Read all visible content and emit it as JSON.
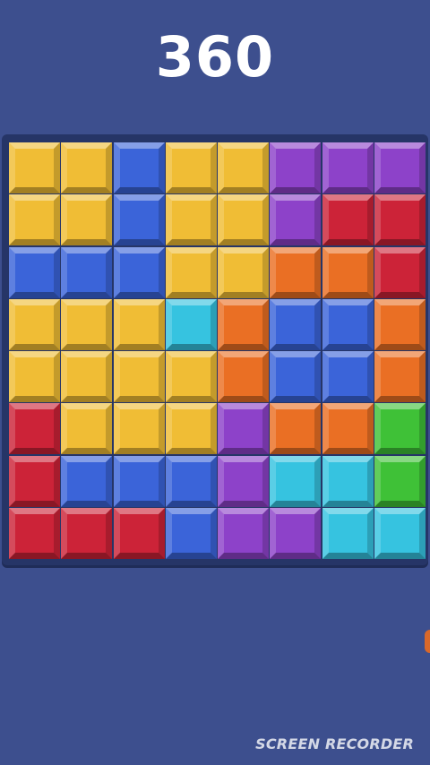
{
  "game": {
    "score": "360",
    "watermark": "SCREEN RECORDER"
  },
  "colors": {
    "background": "#3d4f8e",
    "board": "#263567",
    "yellow": "#f0bd35",
    "blue": "#3b64d9",
    "purple": "#8d42c9",
    "red": "#cc2338",
    "orange": "#ea6f24",
    "cyan": "#36c3e0",
    "green": "#3fc137"
  },
  "board": {
    "rows": [
      [
        "yellow",
        "yellow",
        "blue",
        "yellow",
        "yellow",
        "purple",
        "purple",
        "purple"
      ],
      [
        "yellow",
        "yellow",
        "blue",
        "yellow",
        "yellow",
        "purple",
        "red",
        "red"
      ],
      [
        "blue",
        "blue",
        "blue",
        "yellow",
        "yellow",
        "orange",
        "orange",
        "red"
      ],
      [
        "yellow",
        "yellow",
        "yellow",
        "cyan",
        "orange",
        "blue",
        "blue",
        "orange"
      ],
      [
        "yellow",
        "yellow",
        "yellow",
        "yellow",
        "orange",
        "blue",
        "blue",
        "orange"
      ],
      [
        "red",
        "yellow",
        "yellow",
        "yellow",
        "purple",
        "orange",
        "orange",
        "green"
      ],
      [
        "red",
        "blue",
        "blue",
        "blue",
        "purple",
        "cyan",
        "cyan",
        "green"
      ],
      [
        "red",
        "red",
        "red",
        "blue",
        "purple",
        "purple",
        "cyan",
        "cyan"
      ]
    ]
  }
}
